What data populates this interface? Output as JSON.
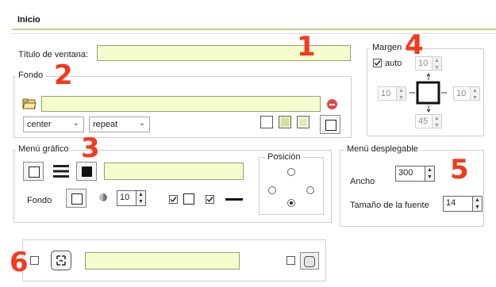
{
  "tab": {
    "title": "Inicio"
  },
  "window_title": {
    "label": "Título de ventana:",
    "value": ""
  },
  "margin": {
    "legend": "Margen",
    "auto_label": "auto",
    "auto_checked": true,
    "top": "10",
    "left": "10",
    "right": "10",
    "bottom": "45"
  },
  "background": {
    "legend": "Fondo",
    "path": "",
    "position_options_selected": "center",
    "repeat_selected": "repeat"
  },
  "graphic_menu": {
    "legend": "Menú gráfico",
    "text_value": "",
    "fondo_label": "Fondo",
    "opacity_value": "10",
    "position_legend": "Posición"
  },
  "dropdown_menu": {
    "legend": "Menú desplegable",
    "width_label": "Ancho",
    "width_value": "300",
    "font_size_label": "Tamaño de la fuente",
    "font_size_value": "14"
  },
  "section6": {
    "text_value": ""
  },
  "markers": {
    "m1": "1",
    "m2": "2",
    "m3": "3",
    "m4": "4",
    "m5": "5",
    "m6": "6"
  },
  "colors": {
    "field_bg": "#f7fccc",
    "tab_underline": "#b9d38a",
    "marker": "#f23a1e"
  }
}
